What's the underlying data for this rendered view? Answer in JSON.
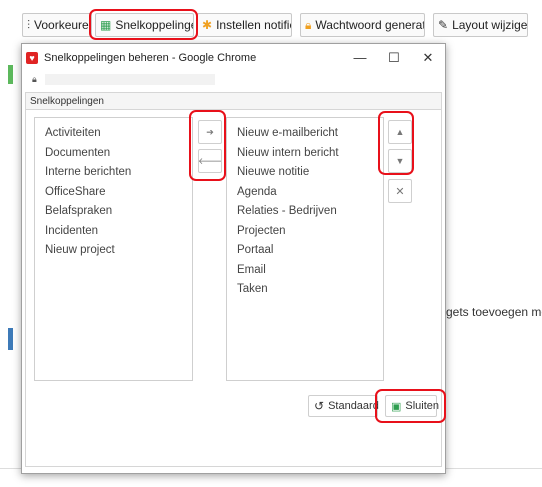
{
  "toolbar": {
    "voorkeuren": "Voorkeuren",
    "snelkoppelingen": "Snelkoppelingen",
    "instellen": "Instellen notifier",
    "wachtwoord": "Wachtwoord generator",
    "layout": "Layout wijzigen"
  },
  "background": {
    "widget_text": "gets toevoegen me"
  },
  "window": {
    "title": "Snelkoppelingen beheren - Google Chrome",
    "controls": {
      "minimize": "—",
      "maximize": "☐",
      "close": "✕"
    },
    "panel_title": "Snelkoppelingen"
  },
  "available": [
    "Activiteiten",
    "Documenten",
    "Interne berichten",
    "OfficeShare",
    "Belafspraken",
    "Incidenten",
    "Nieuw project"
  ],
  "selected": [
    "Nieuw e-mailbericht",
    "Nieuw intern bericht",
    "Nieuwe notitie",
    "Agenda",
    "Relaties - Bedrijven",
    "Projecten",
    "Portaal",
    "Email",
    "Taken"
  ],
  "buttons": {
    "move_right": "➔",
    "move_left": "🡐",
    "up": "▲",
    "down": "▼",
    "remove": "✕",
    "standaard": "Standaard",
    "sluiten": "Sluiten"
  },
  "colors": {
    "highlight": "#e8101a",
    "accent_green": "#5cb85c"
  }
}
